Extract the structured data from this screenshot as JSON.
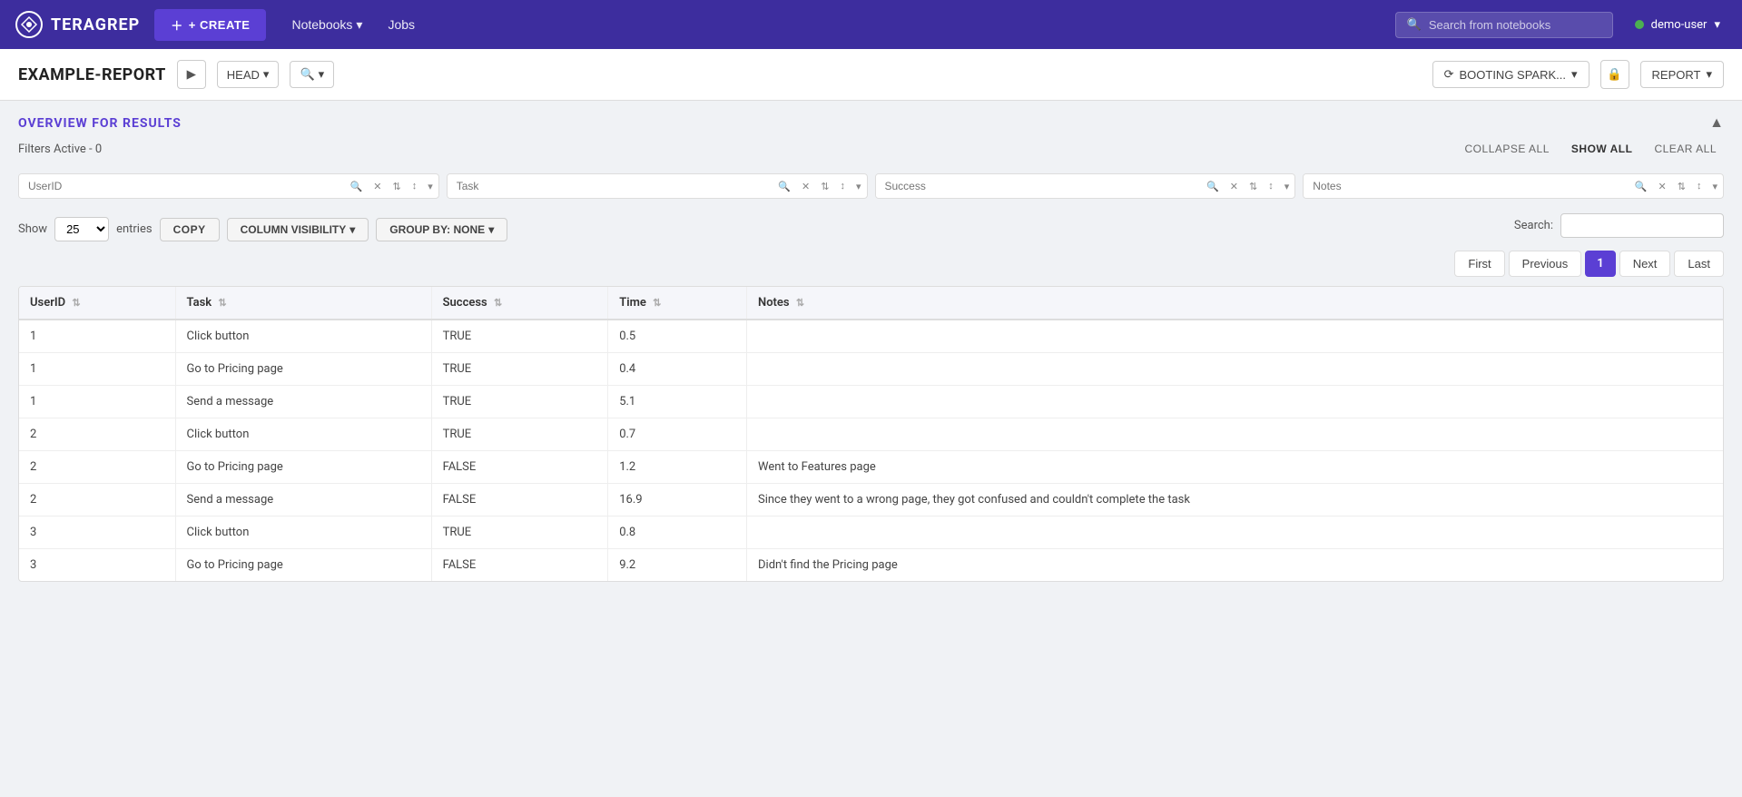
{
  "navbar": {
    "logo_text": "TERAGREP",
    "create_label": "+ CREATE",
    "nav_notebooks": "Notebooks",
    "nav_jobs": "Jobs",
    "search_placeholder": "Search from notebooks",
    "user_label": "demo-user"
  },
  "toolbar": {
    "report_title": "EXAMPLE-REPORT",
    "head_label": "HEAD",
    "booting_label": "BOOTING SPARK...",
    "report_label": "REPORT"
  },
  "overview": {
    "title": "OVERVIEW FOR RESULTS",
    "filters_label": "Filters Active - 0",
    "collapse_all": "COLLAPSE ALL",
    "show_all": "SHOW ALL",
    "clear_all": "CLEAR ALL"
  },
  "column_filters": [
    {
      "placeholder": "UserID"
    },
    {
      "placeholder": "Task"
    },
    {
      "placeholder": "Success"
    },
    {
      "placeholder": "Notes"
    }
  ],
  "table_controls": {
    "show_label": "Show",
    "show_value": "25",
    "entries_label": "entries",
    "copy_label": "COPY",
    "col_vis_label": "COLUMN VISIBILITY",
    "group_by_label": "GROUP BY: NONE",
    "search_label": "Search:"
  },
  "pagination": {
    "first_label": "First",
    "prev_label": "Previous",
    "current_page": "1",
    "next_label": "Next",
    "last_label": "Last"
  },
  "table": {
    "columns": [
      "UserID",
      "Task",
      "Success",
      "Time",
      "Notes"
    ],
    "rows": [
      {
        "userid": "1",
        "task": "Click button",
        "success": "TRUE",
        "time": "0.5",
        "notes": ""
      },
      {
        "userid": "1",
        "task": "Go to Pricing page",
        "success": "TRUE",
        "time": "0.4",
        "notes": ""
      },
      {
        "userid": "1",
        "task": "Send a message",
        "success": "TRUE",
        "time": "5.1",
        "notes": ""
      },
      {
        "userid": "2",
        "task": "Click button",
        "success": "TRUE",
        "time": "0.7",
        "notes": ""
      },
      {
        "userid": "2",
        "task": "Go to Pricing page",
        "success": "FALSE",
        "time": "1.2",
        "notes": "Went to Features page"
      },
      {
        "userid": "2",
        "task": "Send a message",
        "success": "FALSE",
        "time": "16.9",
        "notes": "Since they went to a wrong page, they got confused and couldn't complete the task"
      },
      {
        "userid": "3",
        "task": "Click button",
        "success": "TRUE",
        "time": "0.8",
        "notes": ""
      },
      {
        "userid": "3",
        "task": "Go to Pricing page",
        "success": "FALSE",
        "time": "9.2",
        "notes": "Didn't find the Pricing page"
      }
    ]
  }
}
